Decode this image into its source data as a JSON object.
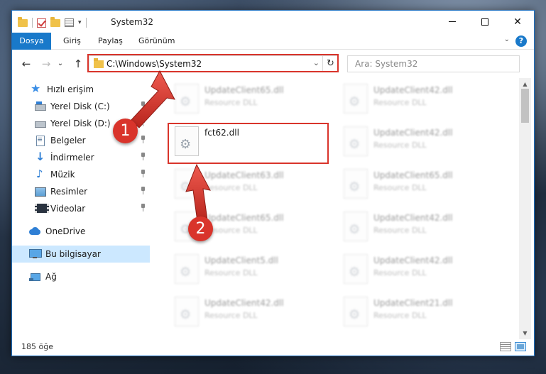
{
  "window": {
    "title": "System32",
    "controls": {
      "minimize": "minimize",
      "maximize": "maximize",
      "close": "✕"
    }
  },
  "ribbon": {
    "tabs": [
      {
        "label": "Dosya"
      },
      {
        "label": "Giriş"
      },
      {
        "label": "Paylaş"
      },
      {
        "label": "Görünüm"
      }
    ],
    "help": "?"
  },
  "address": {
    "path": "C:\\Windows\\System32",
    "refresh_icon": "refresh-icon"
  },
  "search": {
    "placeholder": "Ara: System32"
  },
  "sidebar": {
    "items": [
      {
        "label": "Hızlı erişim",
        "icon": "star-icon"
      },
      {
        "label": "Yerel Disk (C:)",
        "icon": "drive-icon",
        "pinned": true
      },
      {
        "label": "Yerel Disk (D:)",
        "icon": "drive-icon",
        "pinned": true
      },
      {
        "label": "Belgeler",
        "icon": "documents-icon",
        "pinned": true
      },
      {
        "label": "İndirmeler",
        "icon": "download-icon",
        "pinned": true
      },
      {
        "label": "Müzik",
        "icon": "music-icon",
        "pinned": true
      },
      {
        "label": "Resimler",
        "icon": "pictures-icon",
        "pinned": true
      },
      {
        "label": "Videolar",
        "icon": "videos-icon",
        "pinned": true
      },
      {
        "label": "OneDrive",
        "icon": "onedrive-icon"
      },
      {
        "label": "Bu bilgisayar",
        "icon": "computer-icon",
        "selected": true
      },
      {
        "label": "Ağ",
        "icon": "network-icon"
      }
    ]
  },
  "files": [
    {
      "name": "UpdateClient65.dll",
      "type": "Resource DLL",
      "blurred": true
    },
    {
      "name": "UpdateClient42.dll",
      "type": "Resource DLL",
      "blurred": true
    },
    {
      "name": "fct62.dll",
      "type": "",
      "blurred": false,
      "highlighted": true
    },
    {
      "name": "UpdateClient42.dll",
      "type": "Resource DLL",
      "blurred": true
    },
    {
      "name": "UpdateClient63.dll",
      "type": "Resource DLL",
      "blurred": true
    },
    {
      "name": "UpdateClient65.dll",
      "type": "Resource DLL",
      "blurred": true
    },
    {
      "name": "UpdateClient65.dll",
      "type": "Resource DLL",
      "blurred": true
    },
    {
      "name": "UpdateClient42.dll",
      "type": "Resource DLL",
      "blurred": true
    },
    {
      "name": "UpdateClient5.dll",
      "type": "Resource DLL",
      "blurred": true
    },
    {
      "name": "UpdateClient42.dll",
      "type": "Resource DLL",
      "blurred": true
    },
    {
      "name": "UpdateClient42.dll",
      "type": "Resource DLL",
      "blurred": true
    },
    {
      "name": "UpdateClient21.dll",
      "type": "Resource DLL",
      "blurred": true
    }
  ],
  "status": {
    "item_count": "185 öğe"
  },
  "annotations": {
    "step1": "1",
    "step2": "2",
    "color": "#d9342b"
  }
}
